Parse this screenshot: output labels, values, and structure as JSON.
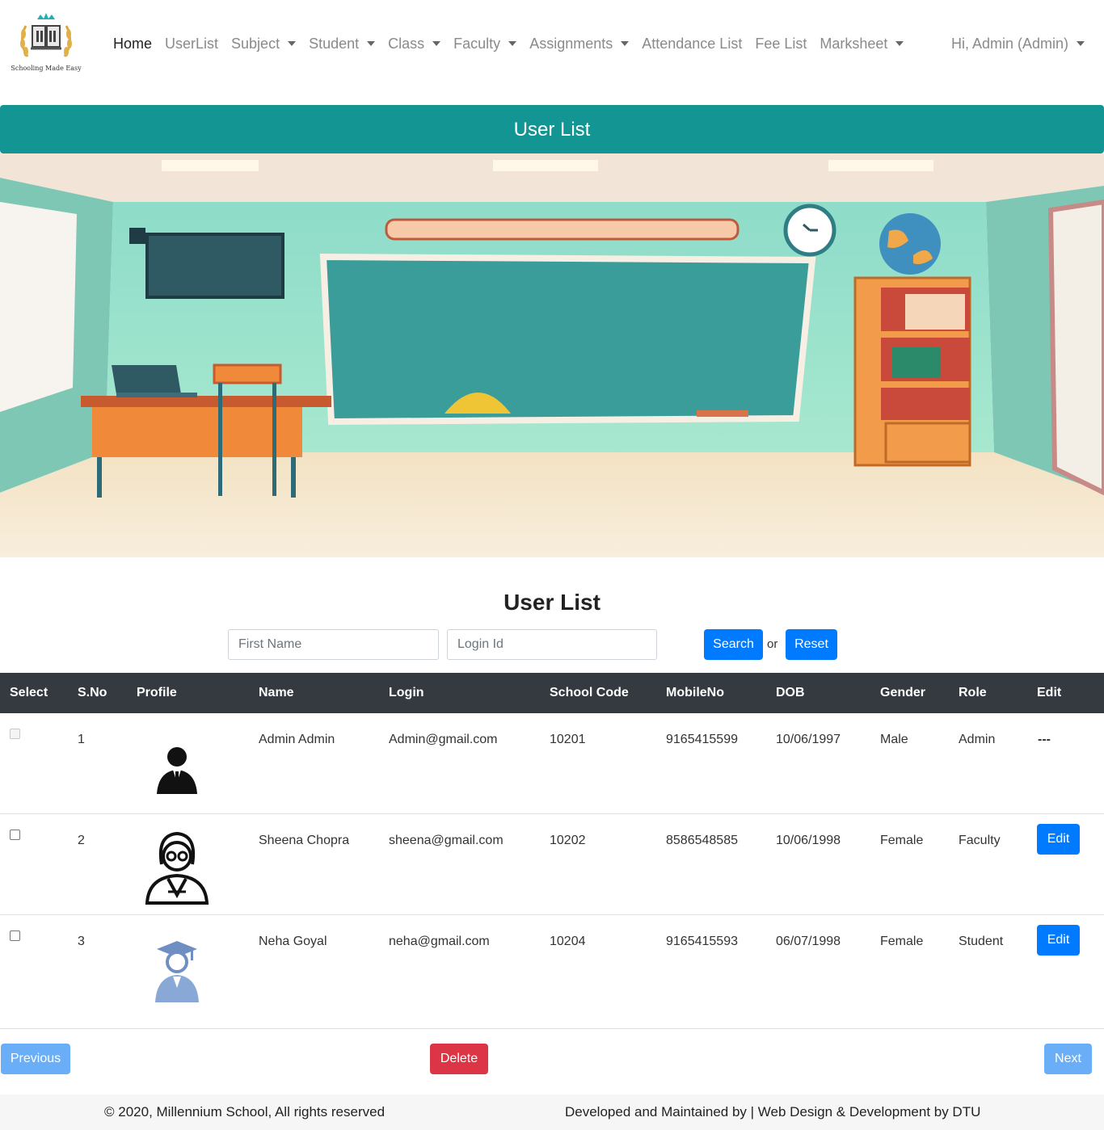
{
  "brand": {
    "tagline": "Schooling Made Easy"
  },
  "nav": {
    "home": "Home",
    "userlist": "UserList",
    "subject": "Subject",
    "student": "Student",
    "class": "Class",
    "faculty": "Faculty",
    "assignments": "Assignments",
    "attendance": "Attendance List",
    "fee": "Fee List",
    "marksheet": "Marksheet",
    "user": "Hi, Admin (Admin)"
  },
  "banner": {
    "title": "User List"
  },
  "main": {
    "title": "User List",
    "search": {
      "first_name_placeholder": "First Name",
      "login_placeholder": "Login Id",
      "search_label": "Search",
      "or_label": "or",
      "reset_label": "Reset"
    }
  },
  "table": {
    "headers": [
      "Select",
      "S.No",
      "Profile",
      "Name",
      "Login",
      "School Code",
      "MobileNo",
      "DOB",
      "Gender",
      "Role",
      "Edit"
    ],
    "rows": [
      {
        "sno": "1",
        "name": "Admin Admin",
        "login": "Admin@gmail.com",
        "school_code": "10201",
        "mobile": "9165415599",
        "dob": "10/06/1997",
        "gender": "Male",
        "role": "Admin",
        "edit": "---",
        "avatar": "admin-avatar-icon"
      },
      {
        "sno": "2",
        "name": "Sheena Chopra",
        "login": "sheena@gmail.com",
        "school_code": "10202",
        "mobile": "8586548585",
        "dob": "10/06/1998",
        "gender": "Female",
        "role": "Faculty",
        "edit": "Edit",
        "avatar": "faculty-avatar-icon"
      },
      {
        "sno": "3",
        "name": "Neha Goyal",
        "login": "neha@gmail.com",
        "school_code": "10204",
        "mobile": "9165415593",
        "dob": "06/07/1998",
        "gender": "Female",
        "role": "Student",
        "edit": "Edit",
        "avatar": "student-avatar-icon"
      }
    ]
  },
  "pagination": {
    "previous": "Previous",
    "delete": "Delete",
    "next": "Next"
  },
  "footer": {
    "copyright": "© 2020, Millennium School, All rights reserved",
    "credits": "Developed and Maintained by | Web Design & Development by DTU"
  },
  "colors": {
    "teal_header": "#139593",
    "primary": "#007bff",
    "danger": "#dc3545",
    "table_header": "#343a40"
  }
}
